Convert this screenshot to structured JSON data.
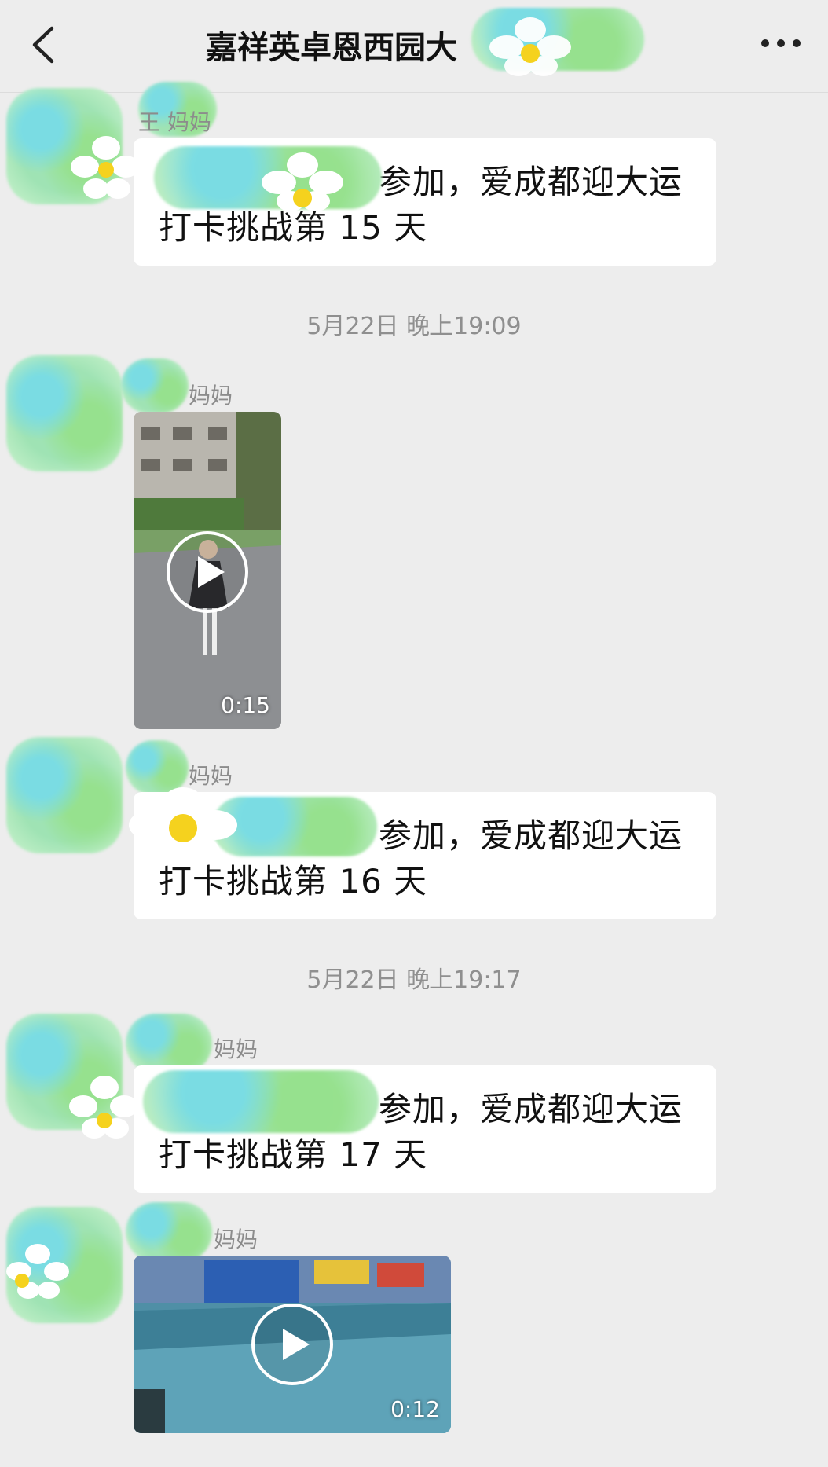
{
  "header": {
    "title": "嘉祥英卓恩西园大",
    "back_icon": "chevron-left-icon",
    "more_icon": "more-horizontal-icon"
  },
  "messages": [
    {
      "type": "text",
      "sender": "王 妈妈",
      "line1": "参加，爱成都迎大运",
      "line2": "打卡挑战第 15 天"
    },
    {
      "type": "timestamp",
      "text": "5月22日 晚上19:09"
    },
    {
      "type": "video",
      "sender": "妈妈",
      "duration": "0:15"
    },
    {
      "type": "text",
      "sender": "妈妈",
      "line1": "参加，爱成都迎大运",
      "line2": "打卡挑战第 16 天"
    },
    {
      "type": "timestamp",
      "text": "5月22日 晚上19:17"
    },
    {
      "type": "text",
      "sender": "妈妈",
      "line1": "参加，爱成都迎大运",
      "line2": "打卡挑战第 17 天"
    },
    {
      "type": "video",
      "sender": "妈妈",
      "duration": "0:12"
    }
  ],
  "colors": {
    "background": "#ededed",
    "bubble": "#ffffff",
    "meta_text": "#8f8f8f"
  }
}
